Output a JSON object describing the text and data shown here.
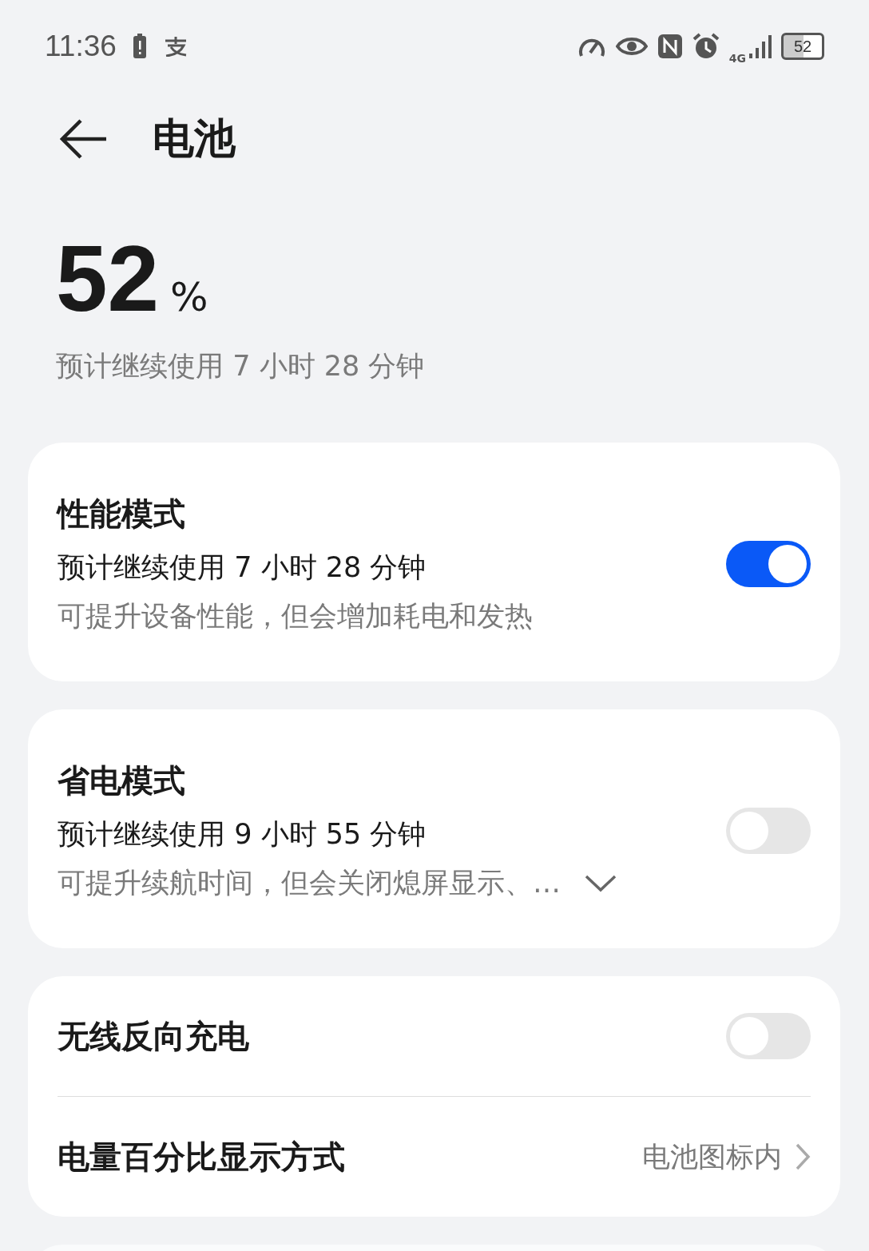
{
  "status_bar": {
    "time": "11:36",
    "network": "4G",
    "battery": "52"
  },
  "header": {
    "title": "电池"
  },
  "battery": {
    "percent": "52",
    "unit": "%",
    "estimate": "预计继续使用 7 小时 28 分钟"
  },
  "cards": [
    {
      "items": [
        {
          "kind": "mode",
          "title": "性能模式",
          "estimate": "预计继续使用 7 小时 28 分钟",
          "description": "可提升设备性能，但会增加耗电和发热",
          "expandable": false,
          "on": true
        }
      ]
    },
    {
      "items": [
        {
          "kind": "mode",
          "title": "省电模式",
          "estimate": "预计继续使用 9 小时 55 分钟",
          "description": "可提升续航时间，但会关闭熄屏显示、…",
          "expandable": true,
          "on": false
        }
      ]
    },
    {
      "items": [
        {
          "kind": "toggle",
          "title": "无线反向充电",
          "on": false
        },
        {
          "kind": "link",
          "title": "电量百分比显示方式",
          "value": "电池图标内"
        }
      ]
    }
  ]
}
